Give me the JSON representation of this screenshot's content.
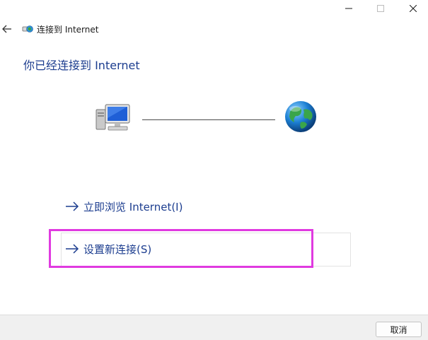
{
  "window": {
    "title": "连接到 Internet",
    "caption_icons": [
      "minimize-icon",
      "maximize-icon",
      "close-icon"
    ]
  },
  "header": {
    "back_icon": "back-arrow-icon",
    "title_icon": "network-icon"
  },
  "main": {
    "heading": "你已经连接到 Internet",
    "status_graphic": {
      "left_icon": "computer-icon",
      "right_icon": "globe-icon"
    },
    "links": [
      {
        "label": "立即浏览 Internet(I)",
        "icon": "arrow-right-icon"
      },
      {
        "label": "设置新连接(S)",
        "icon": "arrow-right-icon",
        "highlighted": true
      }
    ]
  },
  "footer": {
    "cancel_label": "取消"
  },
  "colors": {
    "link": "#1c3d8f",
    "heading": "#1c3d8f",
    "highlight": "#e03ae0",
    "footer_bg": "#f0f0f0"
  }
}
